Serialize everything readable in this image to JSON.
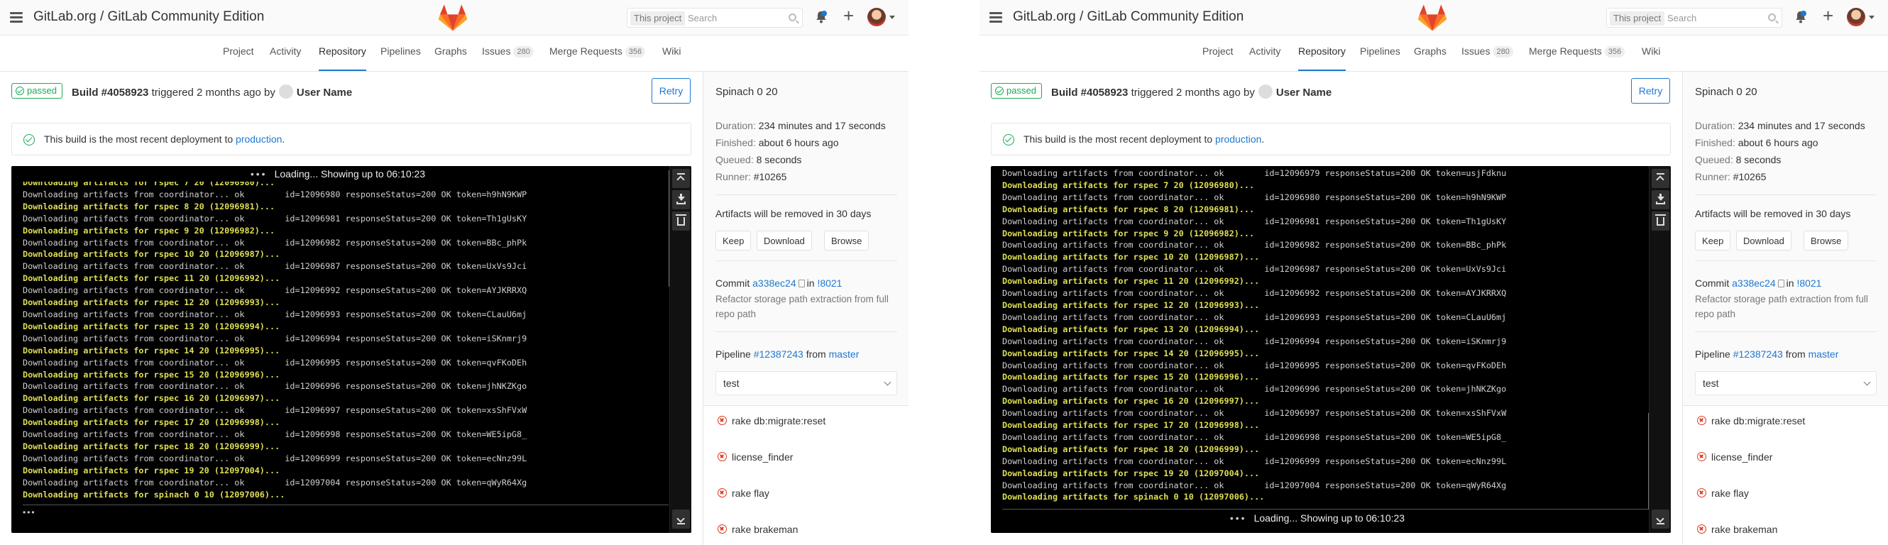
{
  "header": {
    "title": "GitLab.org / GitLab Community Edition",
    "search_scope": "This project",
    "search_placeholder": "Search",
    "todos_count": "",
    "add_label": "+"
  },
  "nav": [
    {
      "label": "Project"
    },
    {
      "label": "Activity"
    },
    {
      "label": "Repository",
      "active": true
    },
    {
      "label": "Pipelines"
    },
    {
      "label": "Graphs"
    },
    {
      "label": "Issues",
      "count": "280"
    },
    {
      "label": "Merge Requests",
      "count": "356"
    },
    {
      "label": "Wiki"
    }
  ],
  "build": {
    "status": "passed",
    "title": "Build #4058923",
    "triggered_text": "triggered 2 months ago by",
    "user": "User Name",
    "retry_label": "Retry",
    "deploy_text": "This build is the most recent deployment to",
    "deploy_env": "production",
    "deploy_end": "."
  },
  "terminal": {
    "loading_text": "Loading... Showing up to 06:10:23",
    "lines_left": [
      {
        "t": "Downloading artifacts for rspec 7 20 (12096980)...",
        "hl": true
      },
      {
        "t": "Downloading artifacts from coordinator... ok        id=12096980 responseStatus=200 OK token=h9hN9KWP",
        "hl": false
      },
      {
        "t": "Downloading artifacts for rspec 8 20 (12096981)...",
        "hl": true
      },
      {
        "t": "Downloading artifacts from coordinator... ok        id=12096981 responseStatus=200 OK token=Th1gUsKY",
        "hl": false
      },
      {
        "t": "Downloading artifacts for rspec 9 20 (12096982)...",
        "hl": true
      },
      {
        "t": "Downloading artifacts from coordinator... ok        id=12096982 responseStatus=200 OK token=BBc_phPk",
        "hl": false
      },
      {
        "t": "Downloading artifacts for rspec 10 20 (12096987)...",
        "hl": true
      },
      {
        "t": "Downloading artifacts from coordinator... ok        id=12096987 responseStatus=200 OK token=UxVs9Jci",
        "hl": false
      },
      {
        "t": "Downloading artifacts for rspec 11 20 (12096992)...",
        "hl": true
      },
      {
        "t": "Downloading artifacts from coordinator... ok        id=12096992 responseStatus=200 OK token=AYJKRRXQ",
        "hl": false
      },
      {
        "t": "Downloading artifacts for rspec 12 20 (12096993)...",
        "hl": true
      },
      {
        "t": "Downloading artifacts from coordinator... ok        id=12096993 responseStatus=200 OK token=CLauU6mj",
        "hl": false
      },
      {
        "t": "Downloading artifacts for rspec 13 20 (12096994)...",
        "hl": true
      },
      {
        "t": "Downloading artifacts from coordinator... ok        id=12096994 responseStatus=200 OK token=iSKnmrj9",
        "hl": false
      },
      {
        "t": "Downloading artifacts for rspec 14 20 (12096995)...",
        "hl": true
      },
      {
        "t": "Downloading artifacts from coordinator... ok        id=12096995 responseStatus=200 OK token=qvFKoDEh",
        "hl": false
      },
      {
        "t": "Downloading artifacts for rspec 15 20 (12096996)...",
        "hl": true
      },
      {
        "t": "Downloading artifacts from coordinator... ok        id=12096996 responseStatus=200 OK token=jhNKZKgo",
        "hl": false
      },
      {
        "t": "Downloading artifacts for rspec 16 20 (12096997)...",
        "hl": true
      },
      {
        "t": "Downloading artifacts from coordinator... ok        id=12096997 responseStatus=200 OK token=xsShFVxW",
        "hl": false
      },
      {
        "t": "Downloading artifacts for rspec 17 20 (12096998)...",
        "hl": true
      },
      {
        "t": "Downloading artifacts from coordinator... ok        id=12096998 responseStatus=200 OK token=WE5ipG8_",
        "hl": false
      },
      {
        "t": "Downloading artifacts for rspec 18 20 (12096999)...",
        "hl": true
      },
      {
        "t": "Downloading artifacts from coordinator... ok        id=12096999 responseStatus=200 OK token=ecNnz99L",
        "hl": false
      },
      {
        "t": "Downloading artifacts for rspec 19 20 (12097004)...",
        "hl": true
      },
      {
        "t": "Downloading artifacts from coordinator... ok        id=12097004 responseStatus=200 OK token=qWyR64Xg",
        "hl": false
      },
      {
        "t": "Downloading artifacts for spinach 0 10 (12097006)...",
        "hl": true
      }
    ],
    "lines_right": [
      {
        "t": "Downloading artifacts from coordinator... ok        id=12096979 responseStatus=200 OK token=usjFdknu",
        "hl": false
      },
      {
        "t": "Downloading artifacts for rspec 7 20 (12096980)...",
        "hl": true
      },
      {
        "t": "Downloading artifacts from coordinator... ok        id=12096980 responseStatus=200 OK token=h9hN9KWP",
        "hl": false
      },
      {
        "t": "Downloading artifacts for rspec 8 20 (12096981)...",
        "hl": true
      },
      {
        "t": "Downloading artifacts from coordinator... ok        id=12096981 responseStatus=200 OK token=Th1gUsKY",
        "hl": false
      },
      {
        "t": "Downloading artifacts for rspec 9 20 (12096982)...",
        "hl": true
      },
      {
        "t": "Downloading artifacts from coordinator... ok        id=12096982 responseStatus=200 OK token=BBc_phPk",
        "hl": false
      },
      {
        "t": "Downloading artifacts for rspec 10 20 (12096987)...",
        "hl": true
      },
      {
        "t": "Downloading artifacts from coordinator... ok        id=12096987 responseStatus=200 OK token=UxVs9Jci",
        "hl": false
      },
      {
        "t": "Downloading artifacts for rspec 11 20 (12096992)...",
        "hl": true
      },
      {
        "t": "Downloading artifacts from coordinator... ok        id=12096992 responseStatus=200 OK token=AYJKRRXQ",
        "hl": false
      },
      {
        "t": "Downloading artifacts for rspec 12 20 (12096993)...",
        "hl": true
      },
      {
        "t": "Downloading artifacts from coordinator... ok        id=12096993 responseStatus=200 OK token=CLauU6mj",
        "hl": false
      },
      {
        "t": "Downloading artifacts for rspec 13 20 (12096994)...",
        "hl": true
      },
      {
        "t": "Downloading artifacts from coordinator... ok        id=12096994 responseStatus=200 OK token=iSKnmrj9",
        "hl": false
      },
      {
        "t": "Downloading artifacts for rspec 14 20 (12096995)...",
        "hl": true
      },
      {
        "t": "Downloading artifacts from coordinator... ok        id=12096995 responseStatus=200 OK token=qvFKoDEh",
        "hl": false
      },
      {
        "t": "Downloading artifacts for rspec 15 20 (12096996)...",
        "hl": true
      },
      {
        "t": "Downloading artifacts from coordinator... ok        id=12096996 responseStatus=200 OK token=jhNKZKgo",
        "hl": false
      },
      {
        "t": "Downloading artifacts for rspec 16 20 (12096997)...",
        "hl": true
      },
      {
        "t": "Downloading artifacts from coordinator... ok        id=12096997 responseStatus=200 OK token=xsShFVxW",
        "hl": false
      },
      {
        "t": "Downloading artifacts for rspec 17 20 (12096998)...",
        "hl": true
      },
      {
        "t": "Downloading artifacts from coordinator... ok        id=12096998 responseStatus=200 OK token=WE5ipG8_",
        "hl": false
      },
      {
        "t": "Downloading artifacts for rspec 18 20 (12096999)...",
        "hl": true
      },
      {
        "t": "Downloading artifacts from coordinator... ok        id=12096999 responseStatus=200 OK token=ecNnz99L",
        "hl": false
      },
      {
        "t": "Downloading artifacts for rspec 19 20 (12097004)...",
        "hl": true
      },
      {
        "t": "Downloading artifacts from coordinator... ok        id=12097004 responseStatus=200 OK token=qWyR64Xg",
        "hl": false
      },
      {
        "t": "Downloading artifacts for spinach 0 10 (12097006)...",
        "hl": true
      }
    ]
  },
  "sidebar": {
    "title": "Spinach 0 20",
    "duration_label": "Duration:",
    "duration": "234 minutes and 17 seconds",
    "finished_label": "Finished:",
    "finished": "about 6 hours ago",
    "queued_label": "Queued:",
    "queued": "8 seconds",
    "runner_label": "Runner:",
    "runner": "#10265",
    "artifacts_text": "Artifacts will be removed in 30 days",
    "keep_label": "Keep",
    "download_label": "Download",
    "browse_label": "Browse",
    "commit_label": "Commit",
    "commit_sha": "a338ec24",
    "commit_in": "in",
    "commit_mr": "!8021",
    "commit_message_1": "Refactor storage path extraction from full",
    "commit_message_2": "repo path",
    "pipeline_label": "Pipeline",
    "pipeline_id": "#12387243",
    "pipeline_from": "from",
    "pipeline_branch": "master",
    "stage": "test",
    "jobs": [
      "rake db:migrate:reset",
      "license_finder",
      "rake flay",
      "rake brakeman"
    ]
  },
  "colors": {
    "success": "#1aaa55",
    "failed": "#db3b21",
    "link": "#1f78d1",
    "terminal_highlight": "#dede55"
  }
}
